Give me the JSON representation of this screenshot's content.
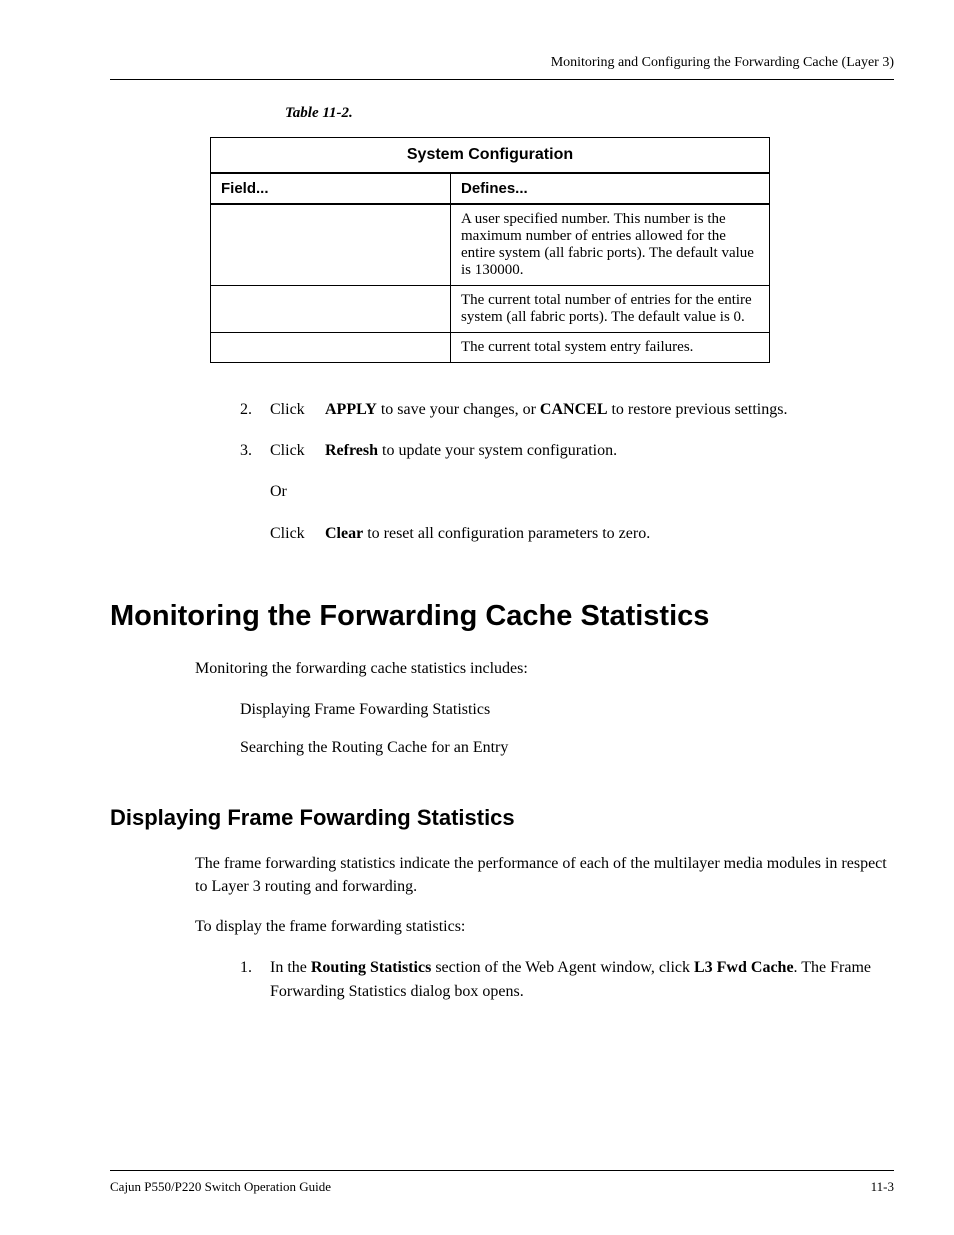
{
  "header": {
    "running_title": "Monitoring and Configuring the Forwarding Cache (Layer 3)"
  },
  "table": {
    "caption": "Table 11-2.",
    "title": "System Configuration",
    "col1": "Field...",
    "col2": "Defines...",
    "rows": [
      {
        "field": "",
        "defines": "A user specified number. This number is the maximum number of entries allowed for the entire system (all fabric ports). The default value is 130000."
      },
      {
        "field": "",
        "defines": "The current total number of entries for the entire system (all fabric ports). The default value is 0."
      },
      {
        "field": "",
        "defines": "The current total system entry failures."
      }
    ]
  },
  "steps": {
    "s2_click": "Click",
    "s2_apply": "APPLY",
    "s2_mid": " to save your changes, or ",
    "s2_cancel": "CANCEL",
    "s2_end": " to restore previous settings.",
    "s3_click": "Click",
    "s3_refresh": "Refresh",
    "s3_end": " to update your system configuration.",
    "or": "Or",
    "s4_click": "Click",
    "s4_clear": "Clear",
    "s4_end": " to reset all configuration parameters to zero.",
    "n2": "2.",
    "n3": "3."
  },
  "h1": "Monitoring the Forwarding Cache Statistics",
  "intro": "Monitoring the forwarding cache statistics includes:",
  "bullets": {
    "b1": "Displaying Frame Fowarding Statistics",
    "b2": "Searching the Routing Cache for an Entry"
  },
  "h2": "Displaying Frame Fowarding Statistics",
  "p1": "The frame forwarding statistics indicate the performance of each of the multilayer media modules in respect to Layer 3 routing and forwarding.",
  "p2": "To display the frame forwarding statistics:",
  "step1": {
    "num": "1.",
    "a": "In the ",
    "b": "Routing Statistics",
    "c": " section of the Web Agent window, click ",
    "d": "L3 Fwd Cache",
    "e": ". The Frame Forwarding Statistics dialog box opens."
  },
  "footer": {
    "left": "Cajun P550/P220 Switch Operation Guide",
    "right": "11-3"
  }
}
